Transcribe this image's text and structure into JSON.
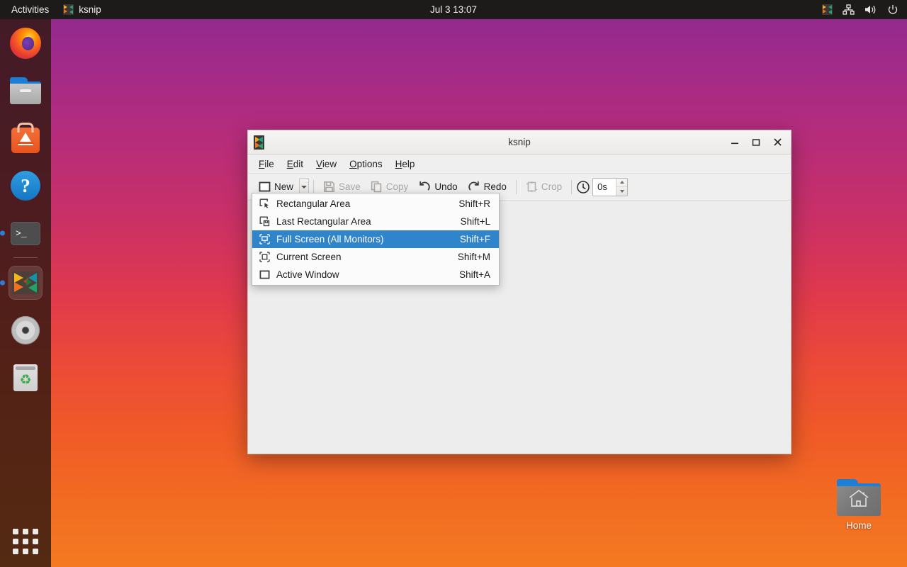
{
  "topbar": {
    "activities": "Activities",
    "app_name": "ksnip",
    "app_icon": "ksnip-icon",
    "clock": "Jul 3  13:07",
    "tray": [
      {
        "name": "ksnip-tray-icon",
        "glyph": "ksnip"
      },
      {
        "name": "network-icon",
        "glyph": "network"
      },
      {
        "name": "volume-icon",
        "glyph": "volume"
      },
      {
        "name": "power-icon",
        "glyph": "power"
      }
    ]
  },
  "dock": {
    "items": [
      {
        "name": "dock-item-firefox",
        "label": "Firefox",
        "icon": "firefox-icon",
        "running": false,
        "active": false
      },
      {
        "name": "dock-item-files",
        "label": "Files",
        "icon": "files-icon",
        "running": false,
        "active": false
      },
      {
        "name": "dock-item-software",
        "label": "Ubuntu Software",
        "icon": "software-icon",
        "running": false,
        "active": false
      },
      {
        "name": "dock-item-help",
        "label": "Help",
        "icon": "help-icon",
        "running": false,
        "active": false
      },
      {
        "name": "dock-item-terminal",
        "label": "Terminal",
        "icon": "terminal-icon",
        "running": true,
        "active": false
      },
      {
        "name": "dock-item-ksnip",
        "label": "ksnip",
        "icon": "ksnip-icon",
        "running": true,
        "active": true
      },
      {
        "name": "dock-item-disc",
        "label": "Disc",
        "icon": "disc-icon",
        "running": false,
        "active": false
      },
      {
        "name": "dock-item-trash",
        "label": "Trash",
        "icon": "trash-icon",
        "running": false,
        "active": false
      }
    ],
    "show_applications": "Show Applications"
  },
  "desktop": {
    "home_icon_label": "Home"
  },
  "window": {
    "title": "ksnip",
    "icon": "ksnip-icon",
    "controls": {
      "minimize": "–",
      "maximize": "☐",
      "close": "✕"
    },
    "menubar": [
      {
        "name": "menu-file",
        "mnemonic": "F",
        "rest": "ile"
      },
      {
        "name": "menu-edit",
        "mnemonic": "E",
        "rest": "dit"
      },
      {
        "name": "menu-view",
        "mnemonic": "V",
        "rest": "iew"
      },
      {
        "name": "menu-options",
        "mnemonic": "O",
        "rest": "ptions"
      },
      {
        "name": "menu-help",
        "mnemonic": "H",
        "rest": "elp"
      }
    ],
    "toolbar": {
      "new_label": "New",
      "save_label": "Save",
      "copy_label": "Copy",
      "undo_label": "Undo",
      "redo_label": "Redo",
      "crop_label": "Crop",
      "delay_value": "0s",
      "delay_icon": "clock-icon"
    },
    "new_menu": {
      "items": [
        {
          "name": "menu-item-rectangular-area",
          "icon": "rectangular-area-icon",
          "label": "Rectangular Area",
          "shortcut": "Shift+R",
          "selected": false
        },
        {
          "name": "menu-item-last-rectangular-area",
          "icon": "last-rectangular-area-icon",
          "label": "Last Rectangular Area",
          "shortcut": "Shift+L",
          "selected": false
        },
        {
          "name": "menu-item-full-screen",
          "icon": "full-screen-icon",
          "label": "Full Screen (All Monitors)",
          "shortcut": "Shift+F",
          "selected": true
        },
        {
          "name": "menu-item-current-screen",
          "icon": "current-screen-icon",
          "label": "Current Screen",
          "shortcut": "Shift+M",
          "selected": false
        },
        {
          "name": "menu-item-active-window",
          "icon": "active-window-icon",
          "label": "Active Window",
          "shortcut": "Shift+A",
          "selected": false
        }
      ]
    }
  },
  "colors": {
    "accent_blue": "#3084c9",
    "topbar_bg": "#1d1b19",
    "window_bg": "#efefef",
    "desktop_gradient_top": "#8e2a8e",
    "desktop_gradient_bottom": "#f47a21"
  }
}
